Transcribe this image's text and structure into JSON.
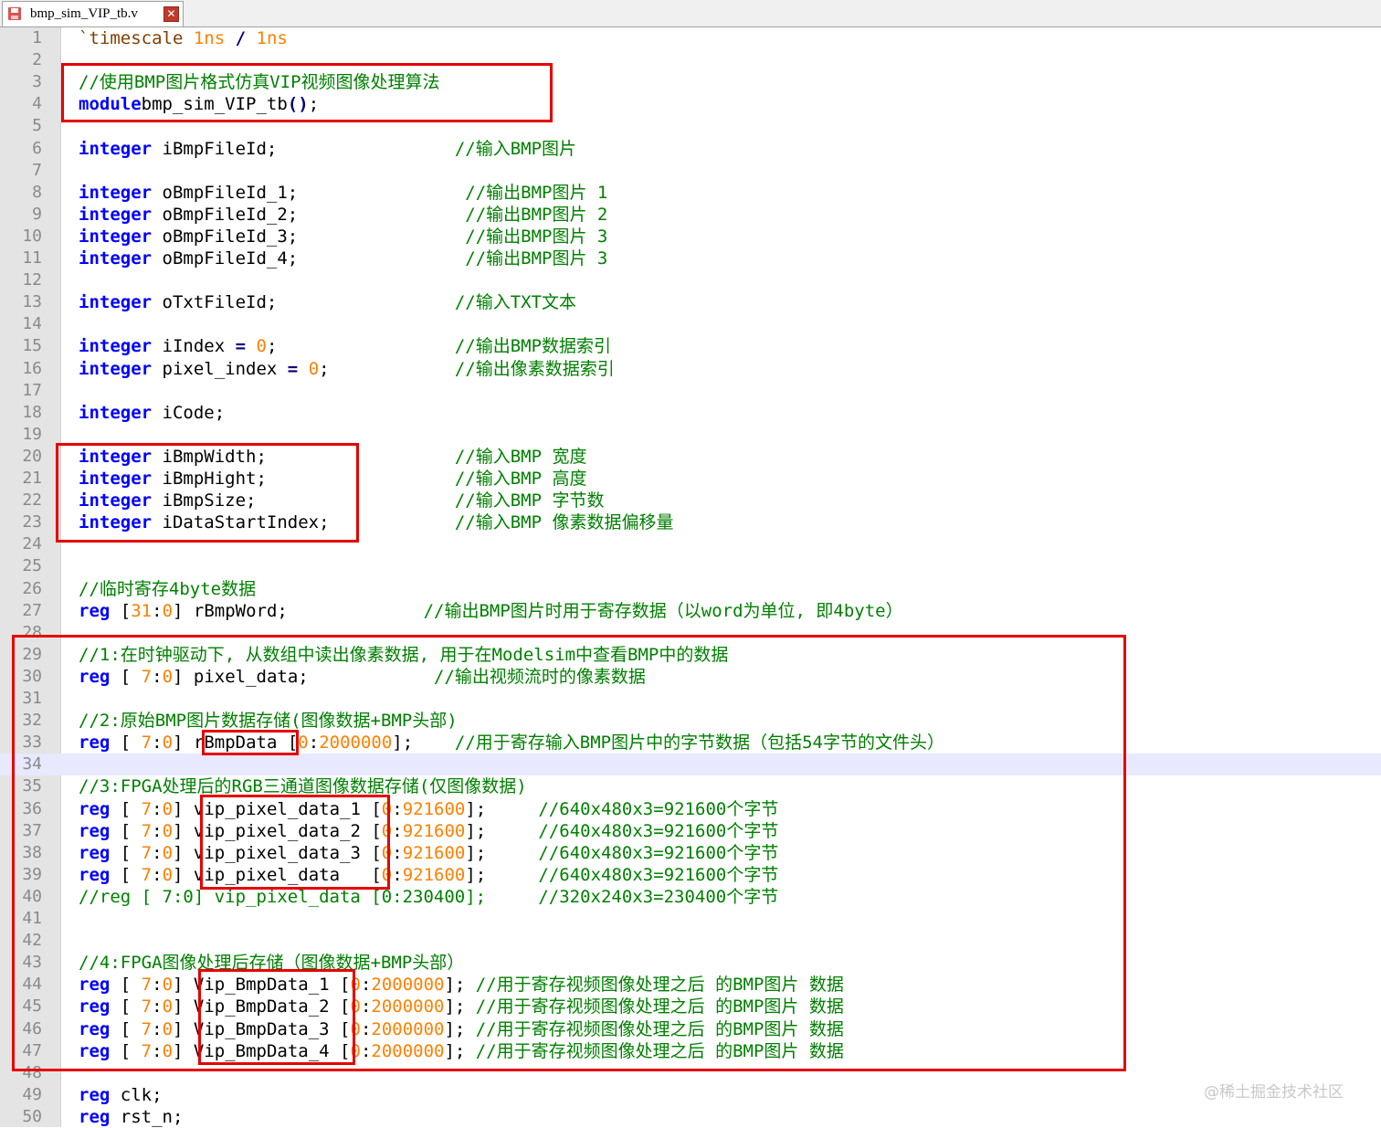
{
  "tab": {
    "filename": "bmp_sim_VIP_tb.v",
    "close_icon": "close-icon",
    "save_icon": "floppy-icon"
  },
  "colors": {
    "keyword": "#0000ff",
    "comment": "#008000",
    "number": "#ff8000",
    "highlight_box": "#e60000",
    "current_line": "#e8e8ff"
  },
  "editor": {
    "current_line": 34,
    "lines": [
      {
        "n": "1",
        "segs": [
          [
            "ts",
            "`timescale "
          ],
          [
            "nm",
            "1ns"
          ],
          [
            "op",
            " / "
          ],
          [
            "nm",
            "1ns"
          ]
        ]
      },
      {
        "n": "2",
        "segs": []
      },
      {
        "n": "3",
        "segs": [
          [
            "cm",
            "//使用BMP图片格式仿真VIP视频图像处理算法"
          ]
        ]
      },
      {
        "n": "4",
        "segs": [
          [
            "kw",
            "module"
          ],
          [
            "",
            "bmp_sim_VIP_tb"
          ],
          [
            "op",
            "()"
          ],
          [
            "",
            ";"
          ]
        ]
      },
      {
        "n": "5",
        "segs": []
      },
      {
        "n": "6",
        "segs": [
          [
            "kw",
            "integer"
          ],
          [
            "",
            " iBmpFileId;                 "
          ],
          [
            "cm",
            "//输入BMP图片"
          ]
        ]
      },
      {
        "n": "7",
        "segs": []
      },
      {
        "n": "8",
        "segs": [
          [
            "kw",
            "integer"
          ],
          [
            "",
            " oBmpFileId_1;                "
          ],
          [
            "cm",
            "//输出BMP图片 1"
          ]
        ]
      },
      {
        "n": "9",
        "segs": [
          [
            "kw",
            "integer"
          ],
          [
            "",
            " oBmpFileId_2;                "
          ],
          [
            "cm",
            "//输出BMP图片 2"
          ]
        ]
      },
      {
        "n": "10",
        "segs": [
          [
            "kw",
            "integer"
          ],
          [
            "",
            " oBmpFileId_3;                "
          ],
          [
            "cm",
            "//输出BMP图片 3"
          ]
        ]
      },
      {
        "n": "11",
        "segs": [
          [
            "kw",
            "integer"
          ],
          [
            "",
            " oBmpFileId_4;                "
          ],
          [
            "cm",
            "//输出BMP图片 3"
          ]
        ]
      },
      {
        "n": "12",
        "segs": []
      },
      {
        "n": "13",
        "segs": [
          [
            "kw",
            "integer"
          ],
          [
            "",
            " oTxtFileId;                 "
          ],
          [
            "cm",
            "//输入TXT文本"
          ]
        ]
      },
      {
        "n": "14",
        "segs": []
      },
      {
        "n": "15",
        "segs": [
          [
            "kw",
            "integer"
          ],
          [
            "",
            " iIndex "
          ],
          [
            "op",
            "="
          ],
          [
            "",
            " "
          ],
          [
            "nm",
            "0"
          ],
          [
            "",
            ";                 "
          ],
          [
            "cm",
            "//输出BMP数据索引"
          ]
        ]
      },
      {
        "n": "16",
        "segs": [
          [
            "kw",
            "integer"
          ],
          [
            "",
            " pixel_index "
          ],
          [
            "op",
            "="
          ],
          [
            "",
            " "
          ],
          [
            "nm",
            "0"
          ],
          [
            "",
            ";            "
          ],
          [
            "cm",
            "//输出像素数据索引"
          ]
        ]
      },
      {
        "n": "17",
        "segs": []
      },
      {
        "n": "18",
        "segs": [
          [
            "kw",
            "integer"
          ],
          [
            "",
            " iCode;"
          ]
        ]
      },
      {
        "n": "19",
        "segs": []
      },
      {
        "n": "20",
        "segs": [
          [
            "kw",
            "integer"
          ],
          [
            "",
            " iBmpWidth;                  "
          ],
          [
            "cm",
            "//输入BMP 宽度"
          ]
        ]
      },
      {
        "n": "21",
        "segs": [
          [
            "kw",
            "integer"
          ],
          [
            "",
            " iBmpHight;                  "
          ],
          [
            "cm",
            "//输入BMP 高度"
          ]
        ]
      },
      {
        "n": "22",
        "segs": [
          [
            "kw",
            "integer"
          ],
          [
            "",
            " iBmpSize;                   "
          ],
          [
            "cm",
            "//输入BMP 字节数"
          ]
        ]
      },
      {
        "n": "23",
        "segs": [
          [
            "kw",
            "integer"
          ],
          [
            "",
            " iDataStartIndex;            "
          ],
          [
            "cm",
            "//输入BMP 像素数据偏移量"
          ]
        ]
      },
      {
        "n": "24",
        "segs": []
      },
      {
        "n": "25",
        "segs": []
      },
      {
        "n": "26",
        "segs": [
          [
            "cm",
            "//临时寄存4byte数据"
          ]
        ]
      },
      {
        "n": "27",
        "segs": [
          [
            "kw",
            "reg"
          ],
          [
            "",
            " ["
          ],
          [
            "nm",
            "31"
          ],
          [
            "",
            ":"
          ],
          [
            "nm",
            "0"
          ],
          [
            "",
            "] rBmpWord;             "
          ],
          [
            "cm",
            "//输出BMP图片时用于寄存数据（以word为单位, 即4byte）"
          ]
        ]
      },
      {
        "n": "28",
        "segs": []
      },
      {
        "n": "29",
        "segs": [
          [
            "cm",
            "//1:在时钟驱动下, 从数组中读出像素数据, 用于在Modelsim中查看BMP中的数据"
          ]
        ]
      },
      {
        "n": "30",
        "segs": [
          [
            "kw",
            "reg"
          ],
          [
            "",
            " [ "
          ],
          [
            "nm",
            "7"
          ],
          [
            "",
            ":"
          ],
          [
            "nm",
            "0"
          ],
          [
            "",
            "] pixel_data;            "
          ],
          [
            "cm",
            "//输出视频流时的像素数据"
          ]
        ]
      },
      {
        "n": "31",
        "segs": []
      },
      {
        "n": "32",
        "segs": [
          [
            "cm",
            "//2:原始BMP图片数据存储(图像数据+BMP头部)"
          ]
        ]
      },
      {
        "n": "33",
        "segs": [
          [
            "kw",
            "reg"
          ],
          [
            "",
            " [ "
          ],
          [
            "nm",
            "7"
          ],
          [
            "",
            ":"
          ],
          [
            "nm",
            "0"
          ],
          [
            "",
            "] rBmpData ["
          ],
          [
            "nm",
            "0"
          ],
          [
            "",
            ":"
          ],
          [
            "nm",
            "2000000"
          ],
          [
            "",
            "];    "
          ],
          [
            "cm",
            "//用于寄存输入BMP图片中的字节数据（包括54字节的文件头）"
          ]
        ]
      },
      {
        "n": "34",
        "segs": []
      },
      {
        "n": "35",
        "segs": [
          [
            "cm",
            "//3:FPGA处理后的RGB三通道图像数据存储(仅图像数据)"
          ]
        ]
      },
      {
        "n": "36",
        "segs": [
          [
            "kw",
            "reg"
          ],
          [
            "",
            " [ "
          ],
          [
            "nm",
            "7"
          ],
          [
            "",
            ":"
          ],
          [
            "nm",
            "0"
          ],
          [
            "",
            "] vip_pixel_data_1 ["
          ],
          [
            "nm",
            "0"
          ],
          [
            "",
            ":"
          ],
          [
            "nm",
            "921600"
          ],
          [
            "",
            "];     "
          ],
          [
            "cm",
            "//640x480x3=921600个字节"
          ]
        ]
      },
      {
        "n": "37",
        "segs": [
          [
            "kw",
            "reg"
          ],
          [
            "",
            " [ "
          ],
          [
            "nm",
            "7"
          ],
          [
            "",
            ":"
          ],
          [
            "nm",
            "0"
          ],
          [
            "",
            "] vip_pixel_data_2 ["
          ],
          [
            "nm",
            "0"
          ],
          [
            "",
            ":"
          ],
          [
            "nm",
            "921600"
          ],
          [
            "",
            "];     "
          ],
          [
            "cm",
            "//640x480x3=921600个字节"
          ]
        ]
      },
      {
        "n": "38",
        "segs": [
          [
            "kw",
            "reg"
          ],
          [
            "",
            " [ "
          ],
          [
            "nm",
            "7"
          ],
          [
            "",
            ":"
          ],
          [
            "nm",
            "0"
          ],
          [
            "",
            "] vip_pixel_data_3 ["
          ],
          [
            "nm",
            "0"
          ],
          [
            "",
            ":"
          ],
          [
            "nm",
            "921600"
          ],
          [
            "",
            "];     "
          ],
          [
            "cm",
            "//640x480x3=921600个字节"
          ]
        ]
      },
      {
        "n": "39",
        "segs": [
          [
            "kw",
            "reg"
          ],
          [
            "",
            " [ "
          ],
          [
            "nm",
            "7"
          ],
          [
            "",
            ":"
          ],
          [
            "nm",
            "0"
          ],
          [
            "",
            "] vip_pixel_data   ["
          ],
          [
            "nm",
            "0"
          ],
          [
            "",
            ":"
          ],
          [
            "nm",
            "921600"
          ],
          [
            "",
            "];     "
          ],
          [
            "cm",
            "//640x480x3=921600个字节"
          ]
        ]
      },
      {
        "n": "40",
        "segs": [
          [
            "cm",
            "//reg [ 7:0] vip_pixel_data [0:230400];     //320x240x3=230400个字节"
          ]
        ]
      },
      {
        "n": "41",
        "segs": []
      },
      {
        "n": "42",
        "segs": []
      },
      {
        "n": "43",
        "segs": [
          [
            "cm",
            "//4:FPGA图像处理后存储（图像数据+BMP头部）"
          ]
        ]
      },
      {
        "n": "44",
        "segs": [
          [
            "kw",
            "reg"
          ],
          [
            "",
            " [ "
          ],
          [
            "nm",
            "7"
          ],
          [
            "",
            ":"
          ],
          [
            "nm",
            "0"
          ],
          [
            "",
            "] Vip_BmpData_1 ["
          ],
          [
            "nm",
            "0"
          ],
          [
            "",
            ":"
          ],
          [
            "nm",
            "2000000"
          ],
          [
            "",
            "]; "
          ],
          [
            "cm",
            "//用于寄存视频图像处理之后 的BMP图片 数据"
          ]
        ]
      },
      {
        "n": "45",
        "segs": [
          [
            "kw",
            "reg"
          ],
          [
            "",
            " [ "
          ],
          [
            "nm",
            "7"
          ],
          [
            "",
            ":"
          ],
          [
            "nm",
            "0"
          ],
          [
            "",
            "] Vip_BmpData_2 ["
          ],
          [
            "nm",
            "0"
          ],
          [
            "",
            ":"
          ],
          [
            "nm",
            "2000000"
          ],
          [
            "",
            "]; "
          ],
          [
            "cm",
            "//用于寄存视频图像处理之后 的BMP图片 数据"
          ]
        ]
      },
      {
        "n": "46",
        "segs": [
          [
            "kw",
            "reg"
          ],
          [
            "",
            " [ "
          ],
          [
            "nm",
            "7"
          ],
          [
            "",
            ":"
          ],
          [
            "nm",
            "0"
          ],
          [
            "",
            "] Vip_BmpData_3 ["
          ],
          [
            "nm",
            "0"
          ],
          [
            "",
            ":"
          ],
          [
            "nm",
            "2000000"
          ],
          [
            "",
            "]; "
          ],
          [
            "cm",
            "//用于寄存视频图像处理之后 的BMP图片 数据"
          ]
        ]
      },
      {
        "n": "47",
        "segs": [
          [
            "kw",
            "reg"
          ],
          [
            "",
            " [ "
          ],
          [
            "nm",
            "7"
          ],
          [
            "",
            ":"
          ],
          [
            "nm",
            "0"
          ],
          [
            "",
            "] Vip_BmpData_4 ["
          ],
          [
            "nm",
            "0"
          ],
          [
            "",
            ":"
          ],
          [
            "nm",
            "2000000"
          ],
          [
            "",
            "]; "
          ],
          [
            "cm",
            "//用于寄存视频图像处理之后 的BMP图片 数据"
          ]
        ]
      },
      {
        "n": "48",
        "segs": []
      },
      {
        "n": "49",
        "segs": [
          [
            "kw",
            "reg"
          ],
          [
            "",
            " clk;"
          ]
        ]
      },
      {
        "n": "50",
        "segs": [
          [
            "kw",
            "reg"
          ],
          [
            "",
            " rst_n;"
          ]
        ]
      }
    ]
  },
  "watermark": "@稀土掘金技术社区"
}
